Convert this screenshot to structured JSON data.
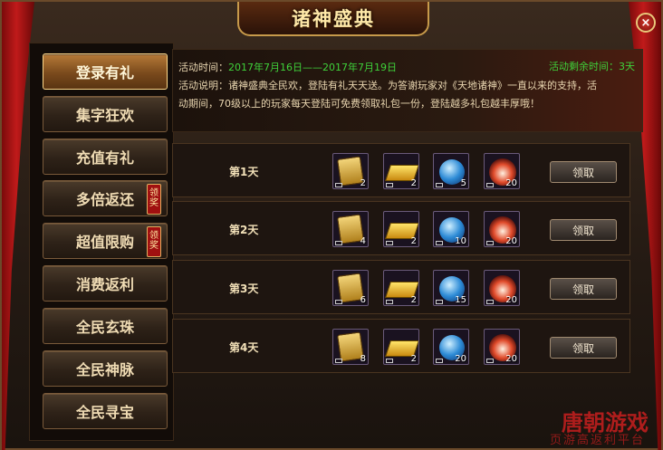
{
  "window": {
    "title": "诸神盛典",
    "close": "×"
  },
  "sidebar": {
    "items": [
      {
        "label": "登录有礼"
      },
      {
        "label": "集字狂欢"
      },
      {
        "label": "充值有礼"
      },
      {
        "label": "多倍返还",
        "badge": "领奖"
      },
      {
        "label": "超值限购",
        "badge": "领奖"
      },
      {
        "label": "消费返利"
      },
      {
        "label": "全民玄珠"
      },
      {
        "label": "全民神脉"
      },
      {
        "label": "全民寻宝"
      }
    ]
  },
  "info": {
    "time_label": "活动时间：",
    "time_value": "2017年7月16日——2017年7月19日",
    "remain": "活动剩余时间：3天",
    "desc_line1": "活动说明：诸神盛典全民欢，登陆有礼天天送。为答谢玩家对《天地诸神》一直以来的支持，活",
    "desc_line2": "动期间，70级以上的玩家每天登陆可免费领取礼包一份，登陆越多礼包越丰厚哦！"
  },
  "rewards": [
    {
      "day": "第1天",
      "counts": [
        "2",
        "2",
        "5",
        "20"
      ],
      "button": "领取"
    },
    {
      "day": "第2天",
      "counts": [
        "4",
        "2",
        "10",
        "20"
      ],
      "button": "领取"
    },
    {
      "day": "第3天",
      "counts": [
        "6",
        "2",
        "15",
        "20"
      ],
      "button": "领取"
    },
    {
      "day": "第4天",
      "counts": [
        "8",
        "2",
        "20",
        "20"
      ],
      "button": "领取"
    }
  ],
  "reward_icons": [
    "scroll-icon",
    "gold-bars-icon",
    "blue-orb-icon",
    "red-orb-icon"
  ],
  "watermark": {
    "brand": "唐朝游戏",
    "slogan": "页游高返利平台"
  },
  "colors": {
    "accent_green": "#3fd23a",
    "gold_text": "#ffe9a8",
    "curtain_red": "#c01a1a"
  }
}
